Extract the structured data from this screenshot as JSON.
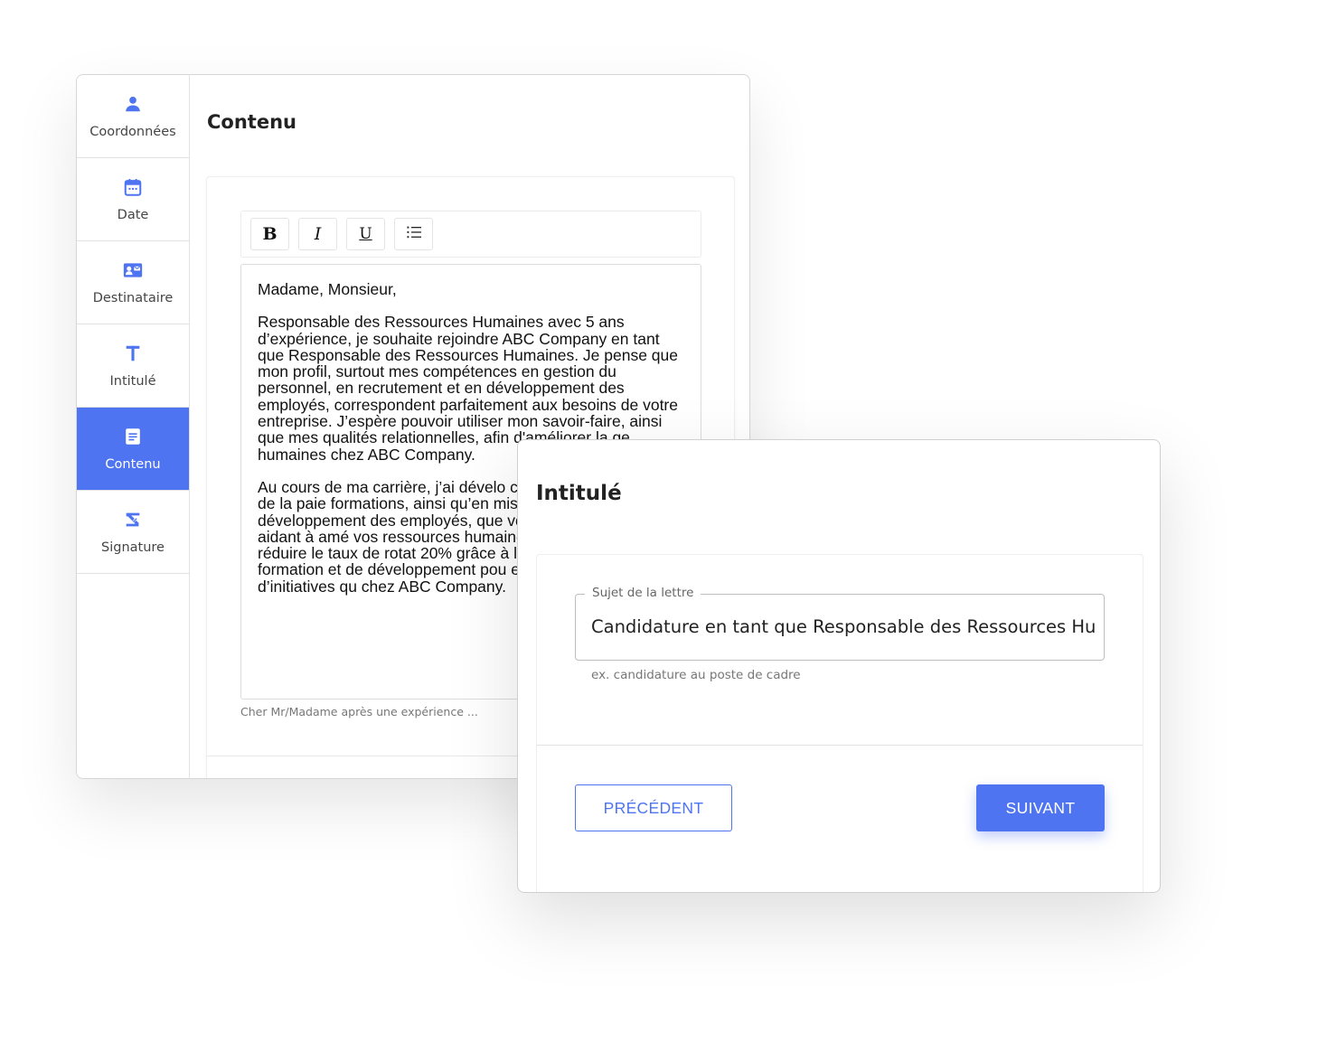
{
  "colors": {
    "accent": "#4f74f1",
    "sidebar_active_bg": "#4f74f1",
    "text_dark": "#222222",
    "text_muted": "#777777"
  },
  "sidebar": {
    "items": [
      {
        "label": "Coordonnées",
        "icon": "user-icon",
        "active": false
      },
      {
        "label": "Date",
        "icon": "calendar-icon",
        "active": false
      },
      {
        "label": "Destinataire",
        "icon": "contact-card-icon",
        "active": false
      },
      {
        "label": "Intitulé",
        "icon": "text-t-icon",
        "active": false
      },
      {
        "label": "Contenu",
        "icon": "document-icon",
        "active": true
      },
      {
        "label": "Signature",
        "icon": "signature-icon",
        "active": false
      }
    ]
  },
  "editor": {
    "title": "Contenu",
    "toolbar": {
      "bold": "B",
      "italic": "I",
      "underline": "U",
      "list_icon": "list-icon"
    },
    "greeting": "Madame, Monsieur,",
    "paragraphs": [
      "Responsable des Ressources Humaines avec 5 ans d’expérience, je souhaite rejoindre ABC Company en tant que Responsable des Ressources Humaines. Je pense que mon profil, surtout mes compétences en gestion du personnel, en recrutement et en développement des employés, correspondent parfaitement aux besoins de votre entreprise. J’espère pouvoir utiliser mon savoir-faire, ainsi que mes qualités relationnelles, afin d'améliorer la ge",
      "Au cours de ma carrière, j’ai dévelo compétences en gestion de la paie formations, ainsi qu’en mise en pla développement des employés, que votre service en vous aidant à amé vos ressources humaines. Dans m j’ai réussi à réduire le taux de rotat 20% grâce à la mise en place d’un formation et de développement pou exactement ce type d’initiatives qu chez ABC Company."
    ],
    "paragraph1_tail": "humaines chez ABC Company.",
    "hint": "Cher Mr/Madame après une expérience ..."
  },
  "intitule": {
    "title": "Intitulé",
    "field_label": "Sujet de la lettre",
    "field_value": "Candidature en tant que Responsable des Ressources Hu",
    "field_help": "ex. candidature au poste de cadre",
    "prev_label": "PRÉCÉDENT",
    "next_label": "SUIVANT"
  }
}
